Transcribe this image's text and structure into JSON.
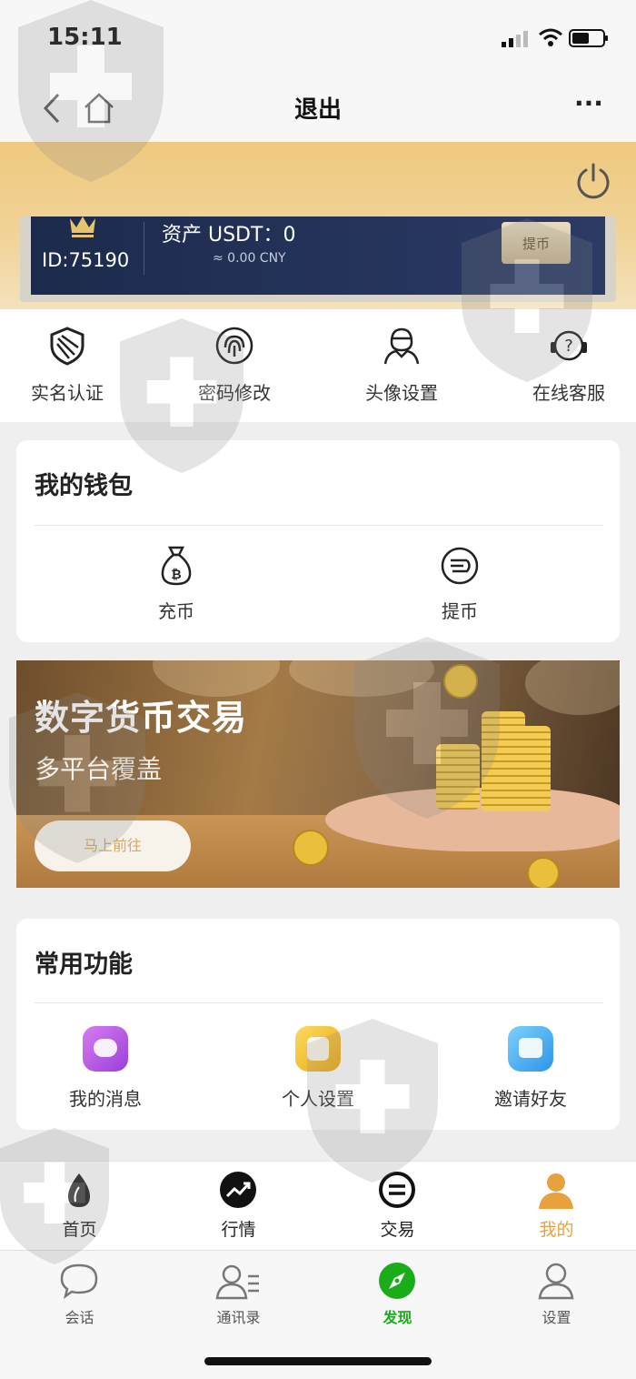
{
  "status": {
    "time": "15:11"
  },
  "nav": {
    "title": "退出",
    "more": "···"
  },
  "account": {
    "id": "ID:75190",
    "asset": "资产 USDT：0",
    "cny": "≈ 0.00 CNY",
    "withdraw_btn": "提币"
  },
  "quick": [
    {
      "label": "实名认证",
      "icon": "shield-icon"
    },
    {
      "label": "密码修改",
      "icon": "fingerprint-icon"
    },
    {
      "label": "头像设置",
      "icon": "avatar-icon"
    },
    {
      "label": "在线客服",
      "icon": "headset-icon"
    }
  ],
  "wallet": {
    "title": "我的钱包",
    "items": [
      {
        "label": "充币",
        "icon": "money-bag-icon"
      },
      {
        "label": "提币",
        "icon": "coin-out-icon"
      }
    ]
  },
  "banner": {
    "title": "数字货币交易",
    "subtitle": "多平台覆盖",
    "button": "马上前往"
  },
  "functions": {
    "title": "常用功能",
    "items": [
      {
        "label": "我的消息",
        "icon": "message-icon",
        "color": "#b352e6"
      },
      {
        "label": "个人设置",
        "icon": "profile-card-icon",
        "color": "#f3bf1f"
      },
      {
        "label": "邀请好友",
        "icon": "invite-icon",
        "color": "#3aa9f0"
      }
    ]
  },
  "tabbar": [
    {
      "label": "首页",
      "icon": "home-drop-icon"
    },
    {
      "label": "行情",
      "icon": "trend-icon"
    },
    {
      "label": "交易",
      "icon": "exchange-icon"
    },
    {
      "label": "我的",
      "icon": "user-icon",
      "active": true
    }
  ],
  "wechat_tabbar": [
    {
      "label": "会话",
      "icon": "chat-bubble-icon"
    },
    {
      "label": "通讯录",
      "icon": "contacts-icon"
    },
    {
      "label": "发现",
      "icon": "compass-icon",
      "active": true
    },
    {
      "label": "设置",
      "icon": "person-icon"
    }
  ],
  "colors": {
    "gold": "#efc97e",
    "navy": "#1c2a4c",
    "active_orange": "#e8a13c",
    "wechat_green": "#1aad19"
  }
}
